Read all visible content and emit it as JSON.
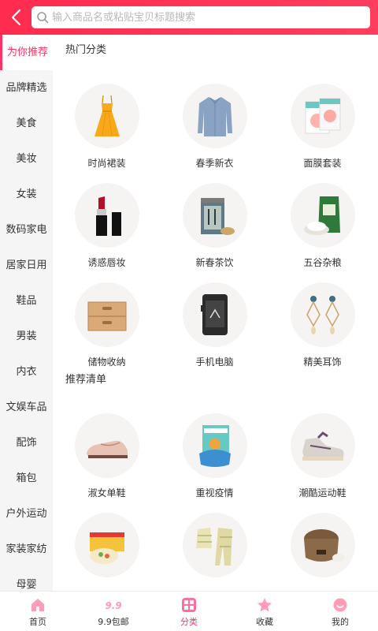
{
  "header": {
    "back_icon": "chevron-left-icon",
    "search_placeholder": "输入商品名或粘贴宝贝标题搜索",
    "colors": {
      "header_bg": "#ff2c4f",
      "accent": "#ff3366"
    }
  },
  "sidebar": {
    "items": [
      {
        "label": "为你推荐",
        "active": true
      },
      {
        "label": "品牌精选"
      },
      {
        "label": "美食"
      },
      {
        "label": "美妆"
      },
      {
        "label": "女装"
      },
      {
        "label": "数码家电"
      },
      {
        "label": "居家日用"
      },
      {
        "label": "鞋品"
      },
      {
        "label": "男装"
      },
      {
        "label": "内衣"
      },
      {
        "label": "文娱车品"
      },
      {
        "label": "配饰"
      },
      {
        "label": "箱包"
      },
      {
        "label": "户外运动"
      },
      {
        "label": "家装家纺"
      },
      {
        "label": "母婴"
      }
    ]
  },
  "hot": {
    "title": "热门分类",
    "items": [
      {
        "label": "时尚裙装",
        "icon": "dress-icon"
      },
      {
        "label": "春季新衣",
        "icon": "shirt-icon"
      },
      {
        "label": "面膜套装",
        "icon": "facemask-box-icon"
      },
      {
        "label": "诱惑唇妆",
        "icon": "lipstick-icon"
      },
      {
        "label": "新春茶饮",
        "icon": "tea-can-icon"
      },
      {
        "label": "五谷杂粮",
        "icon": "rice-bag-icon"
      },
      {
        "label": "储物收纳",
        "icon": "drawer-box-icon"
      },
      {
        "label": "手机电脑",
        "icon": "phone-icon"
      },
      {
        "label": "精美耳饰",
        "icon": "earrings-icon"
      }
    ]
  },
  "recommend": {
    "title": "推荐清单",
    "items": [
      {
        "label": "淑女单鞋",
        "icon": "loafer-icon"
      },
      {
        "label": "重视疫情",
        "icon": "mask-box-icon"
      },
      {
        "label": "潮酷运动鞋",
        "icon": "sneaker-icon"
      },
      {
        "label": "",
        "icon": "snack-box-icon"
      },
      {
        "label": "",
        "icon": "pajamas-icon"
      },
      {
        "label": "",
        "icon": "rice-cooker-icon"
      }
    ]
  },
  "tabbar": {
    "items": [
      {
        "label": "首页",
        "icon": "home-icon"
      },
      {
        "label": "9.9包邮",
        "icon": "price-99-icon",
        "icon_text": "9.9"
      },
      {
        "label": "分类",
        "icon": "category-icon",
        "active": true
      },
      {
        "label": "收藏",
        "icon": "star-icon"
      },
      {
        "label": "我的",
        "icon": "user-icon"
      }
    ]
  }
}
